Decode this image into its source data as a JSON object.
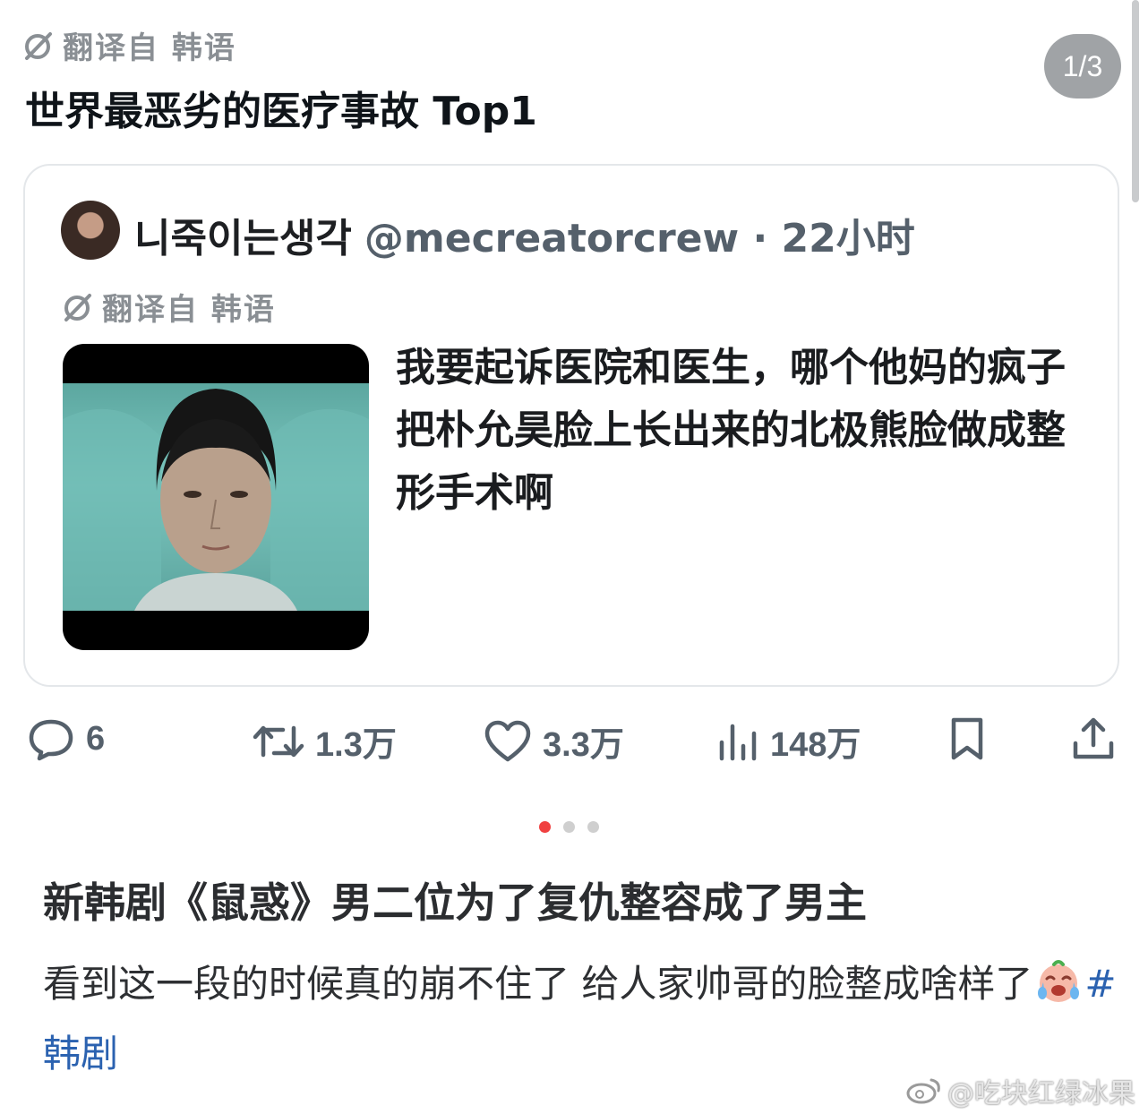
{
  "header": {
    "translate_label": "翻译自 韩语",
    "headline": "世界最恶劣的医疗事故 Top1",
    "pager": "1/3"
  },
  "quoted_tweet": {
    "author_name": "니죽이는생각",
    "author_handle_time": "@mecreatorcrew · 22小时",
    "translate_label": "翻译自 韩语",
    "text": "我要起诉医院和医生，哪个他妈的疯子把朴允昊脸上长出来的北极熊脸做成整形手术啊"
  },
  "actions": {
    "replies": "6",
    "retweets": "1.3万",
    "likes": "3.3万",
    "views": "148万",
    "icons": [
      "reply-icon",
      "retweet-icon",
      "like-icon",
      "views-icon",
      "bookmark-icon",
      "share-icon"
    ]
  },
  "carousel": {
    "total": 3,
    "active": 1
  },
  "post": {
    "title": "新韩剧《鼠惑》男二位为了复仇整容成了男主",
    "body_before": "看到这一段的时候真的崩不住了   给人家帅哥的脸整成啥样了",
    "hashtag": "#韩剧"
  },
  "watermark": "@吃块红绿冰果",
  "colors": {
    "accent_dot": "#f04141",
    "hashtag": "#2b62b0",
    "muted": "#55606b"
  }
}
